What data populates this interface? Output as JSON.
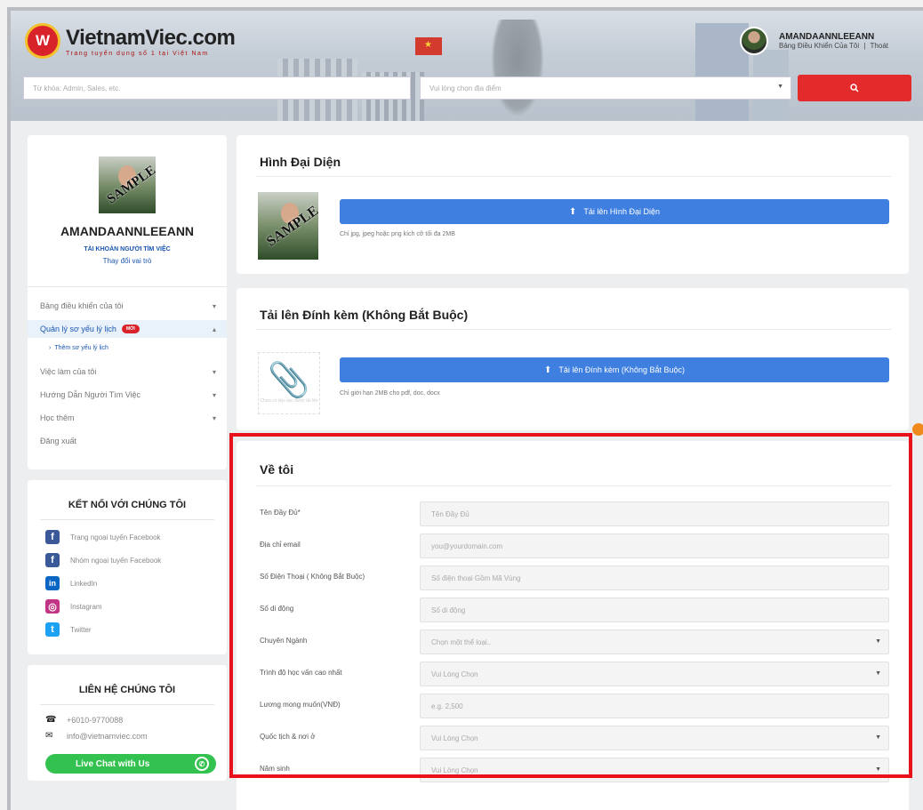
{
  "header": {
    "logo_letter": "W",
    "logo_title": "VietnamViec.com",
    "logo_tagline": "Trang tuyển dụng số 1 tại Việt Nam",
    "user_name": "AMANDAANNLEEANN",
    "user_dashboard_link": "Bảng Điều Khiển Của Tôi",
    "user_link_sep": "|",
    "user_logout_link": "Thoát",
    "search_placeholder": "Từ khóa: Admin, Sales, etc.",
    "location_placeholder": "Vui lòng chọn địa điểm",
    "search_icon": "search-icon"
  },
  "sidebar": {
    "profile": {
      "photo_watermark": "SAMPLE",
      "name": "AMANDAANNLEEANN",
      "role": "TÀI KHOẢN NGƯỜI TÌM VIỆC",
      "switch_role": "Thay đổi vai trò"
    },
    "menu": [
      {
        "label": "Bảng điều khiển của tôi",
        "chevron": "▾"
      },
      {
        "label": "Quản lý sơ yếu lý lịch",
        "badge": "MỚI",
        "chevron": "▴"
      },
      {
        "label": "Việc làm của tôi",
        "chevron": "▾"
      },
      {
        "label": "Hướng Dẫn Người Tìm Việc",
        "chevron": "▾"
      },
      {
        "label": "Học thêm",
        "chevron": "▾"
      },
      {
        "label": "Đăng xuất"
      }
    ],
    "submenu": {
      "label": "Thêm sơ yếu lý lịch",
      "bullet": "›"
    },
    "connect": {
      "title": "KẾT NỐI VỚI CHÚNG TÔI",
      "items": [
        {
          "label": "Trang ngoại tuyến Facebook",
          "icon": "facebook-icon",
          "glyph": "f",
          "color": "#3b5998"
        },
        {
          "label": "Nhóm ngoại tuyến Facebook",
          "icon": "facebook-group-icon",
          "glyph": "f",
          "color": "#3b5998"
        },
        {
          "label": "LinkedIn",
          "icon": "linkedin-icon",
          "glyph": "in",
          "color": "#0a66c2"
        },
        {
          "label": "Instagram",
          "icon": "instagram-icon",
          "glyph": "◎",
          "color": "#c13584"
        },
        {
          "label": "Twitter",
          "icon": "twitter-icon",
          "glyph": "t",
          "color": "#1da1f2"
        }
      ]
    },
    "contact": {
      "title": "LIÊN HỆ CHÚNG TÔI",
      "phone": "+6010-9770088",
      "email": "info@vietnamviec.com",
      "live_chat": "Live Chat with Us"
    }
  },
  "avatar_section": {
    "title": "Hình Đại Diện",
    "photo_watermark": "SAMPLE",
    "upload_button": "Tải lên Hình Đại Diện",
    "hint": "Chỉ jpg, jpeg hoặc png kích cỡ tối đa 2MB"
  },
  "attachment_section": {
    "title": "Tải lên Đính kèm (Không Bắt Buộc)",
    "placeholder_caption": "Chưa có tệp nào được tải lên",
    "upload_button": "Tải lên Đính kèm (Không Bắt Buộc)",
    "hint": "Chỉ giới hạn 2MB cho pdf, doc, docx"
  },
  "about_section": {
    "title": "Về tôi",
    "fields": [
      {
        "label": "Tên Đầy Đủ*",
        "placeholder": "Tên Đầy Đủ",
        "type": "input"
      },
      {
        "label": "Địa chỉ email",
        "placeholder": "you@yourdomain.com",
        "type": "input"
      },
      {
        "label": "Số Điện Thoại ( Không Bắt Buộc)",
        "placeholder": "Số điện thoại Gồm Mã Vùng",
        "type": "input"
      },
      {
        "label": "Số di động",
        "placeholder": "Số di động",
        "type": "input"
      },
      {
        "label": "Chuyên Ngành",
        "placeholder": "Chọn một thể loại..",
        "type": "select"
      },
      {
        "label": "Trình độ học vấn cao nhất",
        "placeholder": "Vui Lòng Chọn",
        "type": "select"
      },
      {
        "label": "Lương mong muốn(VNĐ)",
        "placeholder": "e.g. 2,500",
        "type": "input"
      },
      {
        "label": "Quốc tịch & nơi ở",
        "placeholder": "Vui Lòng Chọn",
        "type": "select"
      },
      {
        "label": "Năm sinh",
        "placeholder": "Vui Lòng Chọn",
        "type": "select"
      }
    ]
  },
  "colors": {
    "brand_red": "#e32b2b",
    "primary_blue": "#3f7fe0",
    "highlight_red": "#e8131a",
    "live_chat_green": "#33c24f"
  }
}
